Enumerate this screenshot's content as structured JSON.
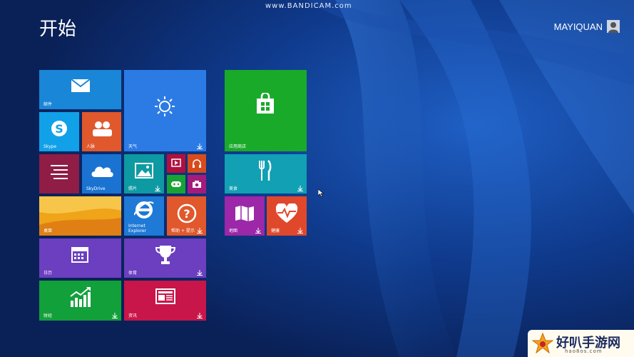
{
  "watermark": "www.BANDICAM.com",
  "title": "开始",
  "user": {
    "name": "MAYIQUAN",
    "icon": "user-avatar-icon"
  },
  "tiles": [
    {
      "id": "mail",
      "label": "邮件",
      "color": "#1a86d8",
      "icon": "mail-icon"
    },
    {
      "id": "weather",
      "label": "天气",
      "color": "#2c7be5",
      "icon": "sun-icon"
    },
    {
      "id": "skype",
      "label": "Skype",
      "color": "#11a1e8",
      "icon": "skype-icon"
    },
    {
      "id": "people",
      "label": "人脉",
      "color": "#e0582c",
      "icon": "people-icon"
    },
    {
      "id": "reading",
      "label": "",
      "color": "#8f1d46",
      "icon": "reading-list-icon"
    },
    {
      "id": "skydrive",
      "label": "SkyDrive",
      "color": "#1a73d0",
      "icon": "cloud-icon"
    },
    {
      "id": "photos",
      "label": "照片",
      "color": "#0e9aa2",
      "icon": "photo-icon"
    },
    {
      "id": "video",
      "label": "",
      "color": "#b0103f",
      "icon": "video-icon"
    },
    {
      "id": "music",
      "label": "",
      "color": "#d84b1c",
      "icon": "headphones-icon"
    },
    {
      "id": "games",
      "label": "",
      "color": "#19a335",
      "icon": "game-controller-icon"
    },
    {
      "id": "camera",
      "label": "",
      "color": "#a51b7c",
      "icon": "camera-icon"
    },
    {
      "id": "desktop",
      "label": "桌面",
      "color": "#f0a419",
      "icon": "desktop-wallpaper"
    },
    {
      "id": "ie",
      "label": "Internet\nExplorer",
      "color": "#1e7ad6",
      "icon": "ie-icon"
    },
    {
      "id": "help",
      "label": "帮助 + 提示",
      "color": "#e0582c",
      "icon": "help-icon"
    },
    {
      "id": "calendar",
      "label": "日历",
      "color": "#6b3fbf",
      "icon": "calendar-icon"
    },
    {
      "id": "sports",
      "label": "体育",
      "color": "#6b3fbf",
      "icon": "trophy-icon"
    },
    {
      "id": "finance",
      "label": "财经",
      "color": "#12a03a",
      "icon": "chart-icon"
    },
    {
      "id": "news",
      "label": "资讯",
      "color": "#c8154a",
      "icon": "news-icon"
    },
    {
      "id": "store",
      "label": "应用商店",
      "color": "#1aaa2a",
      "icon": "store-bag-icon"
    },
    {
      "id": "food",
      "label": "美食",
      "color": "#11a0b4",
      "icon": "fork-knife-icon"
    },
    {
      "id": "maps",
      "label": "地图",
      "color": "#9c27a8",
      "icon": "map-icon"
    },
    {
      "id": "health",
      "label": "健康",
      "color": "#e0482c",
      "icon": "heartbeat-icon"
    }
  ],
  "logo": {
    "title": "好叭手游网",
    "subtitle": "hao8os.com"
  }
}
